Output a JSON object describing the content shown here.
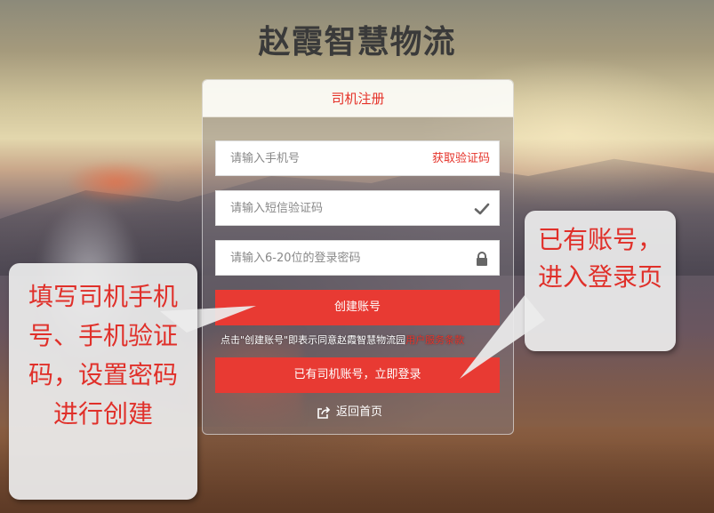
{
  "app": {
    "title": "赵霞智慧物流"
  },
  "register_panel": {
    "header": "司机注册",
    "phone_placeholder": "请输入手机号",
    "get_code_label": "获取验证码",
    "sms_code_placeholder": "请输入短信验证码",
    "password_placeholder": "请输入6-20位的登录密码",
    "create_button_label": "创建账号",
    "agreement_text": "点击\"创建账号\"即表示同意赵霞智慧物流园",
    "agreement_link": "用户服务条款",
    "login_button_label": "已有司机账号，立即登录",
    "back_home_label": "返回首页"
  },
  "icons": {
    "sms_code_icon": "check-icon",
    "password_icon": "lock-icon",
    "back_home_icon": "share-out-icon"
  },
  "annotations": {
    "left_callout": "填写司机手机号、手机验证码，设置密码进行创建",
    "right_callout": "已有账号，进入登录页"
  },
  "colors": {
    "accent": "#e83a33",
    "callout_text": "#e0302a",
    "callout_bg": "#ececec"
  }
}
